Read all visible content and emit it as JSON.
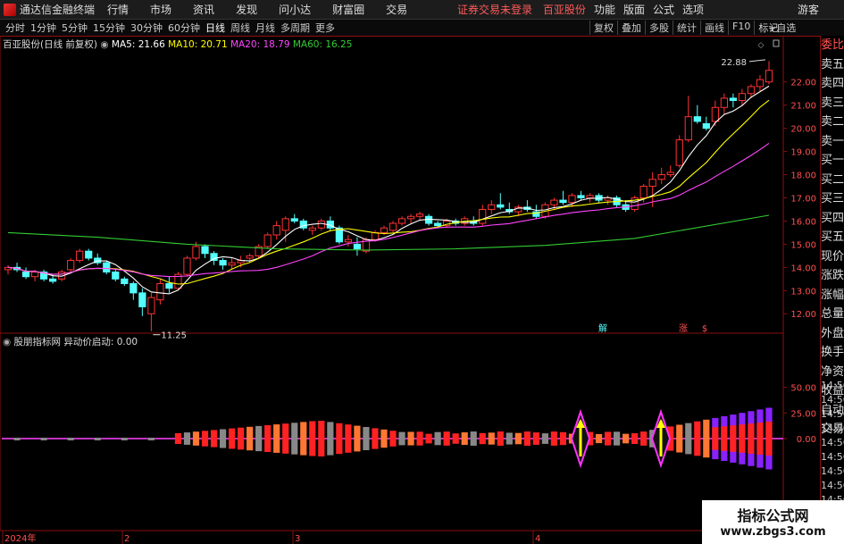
{
  "menubar": {
    "app_title": "通达信金融终端",
    "items": [
      "行情",
      "市场",
      "资讯",
      "发现",
      "问小达",
      "财富圈",
      "交易"
    ],
    "center": [
      "证券交易未登录",
      "百亚股份"
    ],
    "right": [
      "功能",
      "版面",
      "公式",
      "选项"
    ],
    "guest": "游客"
  },
  "periodbar": {
    "periods": [
      "分时",
      "1分钟",
      "5分钟",
      "15分钟",
      "30分钟",
      "60分钟",
      "日线",
      "周线",
      "月线",
      "多周期",
      "更多"
    ],
    "active": "日线",
    "tools": [
      "复权",
      "叠加",
      "多股",
      "统计",
      "画线",
      "F10",
      "标记"
    ],
    "add_fav": "+自选"
  },
  "main_legend": {
    "title": "百亚股份(日线 前复权)",
    "ma5": "MA5: 21.66",
    "ma10": "MA10: 20.71",
    "ma20": "MA20: 18.79",
    "ma60": "MA60: 16.25"
  },
  "indicator_legend": {
    "name": "股朋指标网",
    "value": "异动价启动: 0.00"
  },
  "price_axis": [
    "22.00",
    "21.00",
    "20.00",
    "19.00",
    "18.00",
    "17.00",
    "16.00",
    "15.00",
    "14.00",
    "13.00",
    "12.00"
  ],
  "indicator_axis": [
    "50.00",
    "25.00",
    "0.00"
  ],
  "date_axis": [
    "2024年",
    "2",
    "3",
    "4"
  ],
  "annotations": {
    "high": "22.88",
    "low": "11.25",
    "jie": "解",
    "zhang": "涨",
    "dollar": "$"
  },
  "side_panel": {
    "items": [
      "委比",
      "卖五",
      "卖四",
      "卖三",
      "卖二",
      "卖一",
      "买一",
      "买二",
      "买三",
      "买四",
      "买五",
      "现价",
      "涨跌",
      "涨幅",
      "总量",
      "外盘",
      "换手",
      "净资",
      "收益",
      "自动",
      "交易"
    ],
    "times": [
      "14:56",
      "14:56",
      "14:56",
      "14:56",
      "14:56",
      "14:56",
      "14:56",
      "14:56",
      "14:56",
      "14:56"
    ]
  },
  "watermark": {
    "line1": "指标公式网",
    "line2": "www.zbgs3.com"
  },
  "colors": {
    "up": "#ff3232",
    "down": "#54ffff",
    "ma5": "#ffffff",
    "ma10": "#ffff00",
    "ma20": "#ff44ff",
    "ma60": "#33cc33",
    "bar_red": "#ff2222",
    "bar_orange": "#ff7733",
    "bar_gray": "#888888",
    "bar_purple": "#8822ff",
    "diamond": "#ff33ff",
    "arrow": "#ffff00"
  },
  "chart_data": {
    "type": "candlestick",
    "ylim": [
      11.2,
      23.3
    ],
    "candles": [
      [
        13.9,
        14.1,
        13.7,
        14.0
      ],
      [
        14.0,
        14.2,
        13.8,
        13.9
      ],
      [
        13.8,
        14.0,
        13.5,
        13.6
      ],
      [
        13.6,
        13.9,
        13.4,
        13.8
      ],
      [
        13.8,
        13.9,
        13.4,
        13.5
      ],
      [
        13.5,
        13.7,
        13.3,
        13.4
      ],
      [
        13.5,
        13.9,
        13.4,
        13.8
      ],
      [
        13.9,
        14.4,
        13.8,
        14.3
      ],
      [
        14.3,
        14.8,
        14.2,
        14.7
      ],
      [
        14.7,
        14.8,
        14.3,
        14.4
      ],
      [
        14.4,
        14.6,
        14.1,
        14.2
      ],
      [
        14.2,
        14.3,
        13.7,
        13.8
      ],
      [
        13.8,
        13.9,
        13.4,
        13.5
      ],
      [
        13.5,
        13.6,
        13.2,
        13.3
      ],
      [
        13.3,
        13.4,
        12.6,
        12.9
      ],
      [
        12.9,
        13.1,
        11.9,
        12.3
      ],
      [
        12.0,
        12.9,
        11.25,
        12.7
      ],
      [
        12.6,
        13.5,
        12.4,
        13.3
      ],
      [
        13.3,
        13.6,
        12.9,
        13.1
      ],
      [
        13.1,
        13.8,
        13.0,
        13.7
      ],
      [
        13.7,
        14.5,
        13.6,
        14.4
      ],
      [
        14.4,
        15.1,
        14.3,
        14.9
      ],
      [
        14.9,
        15.0,
        14.4,
        14.6
      ],
      [
        14.6,
        14.7,
        14.1,
        14.3
      ],
      [
        14.3,
        14.4,
        13.9,
        14.1
      ],
      [
        14.1,
        14.4,
        13.9,
        14.2
      ],
      [
        14.2,
        14.5,
        14.0,
        14.3
      ],
      [
        14.4,
        14.6,
        14.2,
        14.5
      ],
      [
        14.5,
        15.0,
        14.4,
        14.9
      ],
      [
        14.9,
        15.5,
        14.8,
        15.4
      ],
      [
        15.4,
        16.0,
        15.2,
        15.8
      ],
      [
        15.6,
        16.2,
        15.1,
        16.1
      ],
      [
        16.1,
        16.3,
        15.9,
        16.0
      ],
      [
        16.0,
        16.1,
        15.6,
        15.7
      ],
      [
        15.6,
        15.8,
        15.4,
        15.7
      ],
      [
        15.7,
        16.1,
        15.6,
        16.0
      ],
      [
        16.0,
        16.2,
        15.6,
        15.7
      ],
      [
        15.7,
        15.8,
        15.0,
        15.1
      ],
      [
        15.1,
        15.4,
        14.9,
        15.2
      ],
      [
        15.0,
        15.3,
        14.5,
        14.8
      ],
      [
        14.7,
        15.3,
        14.6,
        15.2
      ],
      [
        15.2,
        15.6,
        15.1,
        15.5
      ],
      [
        15.5,
        15.8,
        15.4,
        15.7
      ],
      [
        15.6,
        16.0,
        15.5,
        15.9
      ],
      [
        15.9,
        16.2,
        15.8,
        16.1
      ],
      [
        16.1,
        16.3,
        15.9,
        16.2
      ],
      [
        16.2,
        16.4,
        16.0,
        16.3
      ],
      [
        16.2,
        16.3,
        15.8,
        15.9
      ],
      [
        15.9,
        16.0,
        15.7,
        15.8
      ],
      [
        15.8,
        16.1,
        15.7,
        16.0
      ],
      [
        16.0,
        16.1,
        15.8,
        15.9
      ],
      [
        15.9,
        16.2,
        15.8,
        16.1
      ],
      [
        16.0,
        16.2,
        15.8,
        15.9
      ],
      [
        15.9,
        16.7,
        15.8,
        16.5
      ],
      [
        16.5,
        16.9,
        16.3,
        16.7
      ],
      [
        16.7,
        17.2,
        16.5,
        16.6
      ],
      [
        16.5,
        16.8,
        16.3,
        16.4
      ],
      [
        16.4,
        16.7,
        16.2,
        16.6
      ],
      [
        16.6,
        16.9,
        16.4,
        16.5
      ],
      [
        16.4,
        16.7,
        16.1,
        16.2
      ],
      [
        16.2,
        16.8,
        16.1,
        16.7
      ],
      [
        16.7,
        17.0,
        16.5,
        16.9
      ],
      [
        16.9,
        17.3,
        16.7,
        16.8
      ],
      [
        16.8,
        17.2,
        16.6,
        17.1
      ],
      [
        17.1,
        17.3,
        16.9,
        17.0
      ],
      [
        17.0,
        17.2,
        16.8,
        17.1
      ],
      [
        17.1,
        17.2,
        16.8,
        16.9
      ],
      [
        16.9,
        17.1,
        16.7,
        17.0
      ],
      [
        17.0,
        17.1,
        16.6,
        16.7
      ],
      [
        16.7,
        16.9,
        16.4,
        16.5
      ],
      [
        16.5,
        17.1,
        16.4,
        17.0
      ],
      [
        17.0,
        17.6,
        16.8,
        17.5
      ],
      [
        17.5,
        18.1,
        16.6,
        17.8
      ],
      [
        17.8,
        18.3,
        17.6,
        18.0
      ],
      [
        18.0,
        18.4,
        17.9,
        18.1
      ],
      [
        18.4,
        19.7,
        18.3,
        19.5
      ],
      [
        19.5,
        21.4,
        19.4,
        20.5
      ],
      [
        20.5,
        21.0,
        20.2,
        20.3
      ],
      [
        20.2,
        20.5,
        19.9,
        20.0
      ],
      [
        20.3,
        21.2,
        20.1,
        20.9
      ],
      [
        20.9,
        21.5,
        20.6,
        21.3
      ],
      [
        21.3,
        21.5,
        20.9,
        21.2
      ],
      [
        21.2,
        21.7,
        21.0,
        21.5
      ],
      [
        21.5,
        21.9,
        21.3,
        21.8
      ],
      [
        21.8,
        22.3,
        21.6,
        22.1
      ],
      [
        22.0,
        22.9,
        21.9,
        22.5
      ]
    ]
  }
}
